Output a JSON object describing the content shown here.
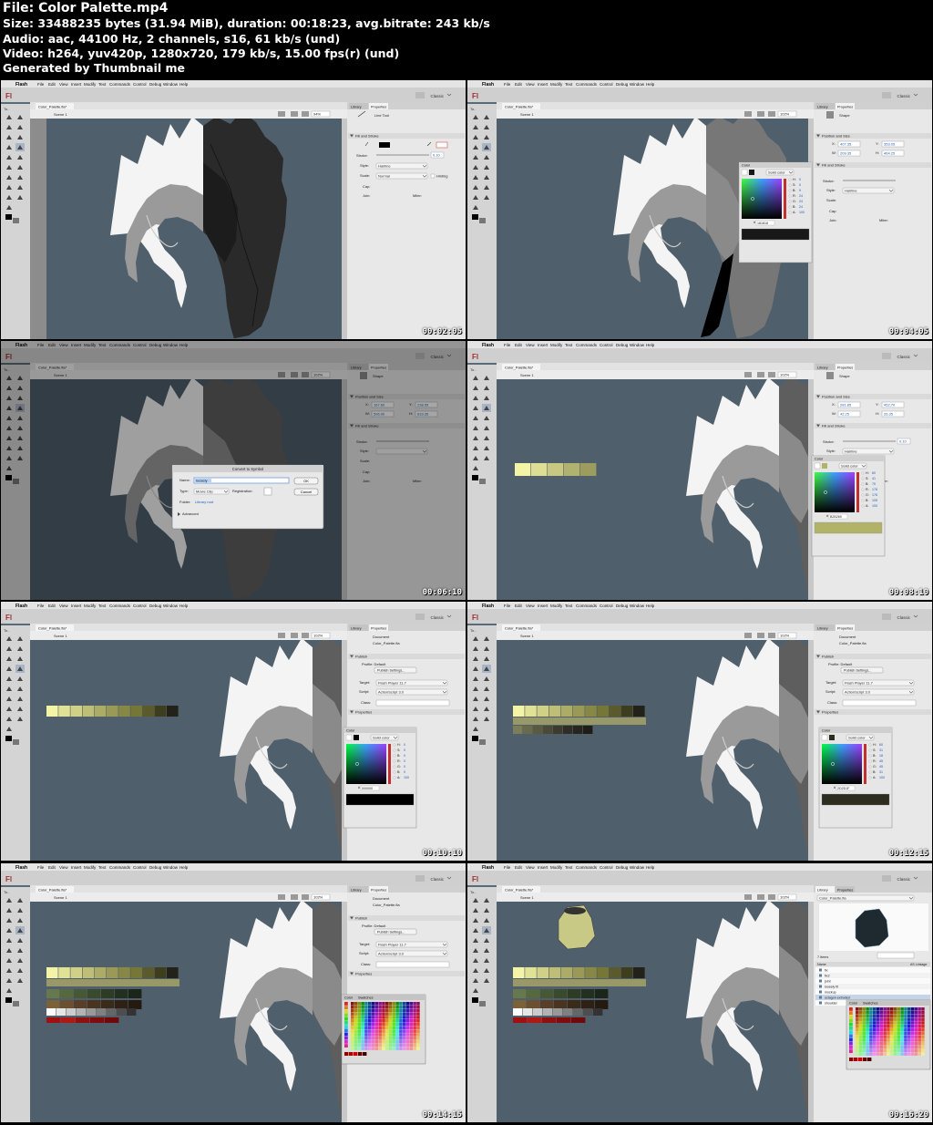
{
  "header": {
    "file": "File: Color Palette.mp4",
    "size": "Size: 33488235 bytes (31.94 MiB), duration: 00:18:23, avg.bitrate: 243 kb/s",
    "audio": "Audio: aac, 44100 Hz, 2 channels, s16, 61 kb/s (und)",
    "video": "Video: h264, yuv420p, 1280x720, 179 kb/s, 15.00 fps(r) (und)",
    "generated": "Generated by Thumbnail me"
  },
  "app": {
    "apple": "",
    "name": "Flash",
    "menus": [
      "File",
      "Edit",
      "View",
      "Insert",
      "Modify",
      "Text",
      "Commands",
      "Control",
      "Debug",
      "Window",
      "Help"
    ],
    "workspace": "Classic",
    "logo": "Fl",
    "doc_tab": "Color_Palette.fla*",
    "scene": "Scene 1",
    "tools_label": "To..",
    "panel_tabs": [
      "Library",
      "Properties"
    ]
  },
  "frames": [
    {
      "timestamp": "00:02:05",
      "zoom": "94%",
      "panel": "line-tool"
    },
    {
      "timestamp": "00:04:05",
      "zoom": "102%",
      "panel": "shape-color"
    },
    {
      "timestamp": "00:06:10",
      "zoom": "102%",
      "panel": "shape-dialog"
    },
    {
      "timestamp": "00:08:10",
      "zoom": "102%",
      "panel": "shape-color2"
    },
    {
      "timestamp": "00:10:10",
      "zoom": "102%",
      "panel": "document-color"
    },
    {
      "timestamp": "00:12:15",
      "zoom": "102%",
      "panel": "document-color2"
    },
    {
      "timestamp": "00:14:15",
      "zoom": "102%",
      "panel": "document-swatches"
    },
    {
      "timestamp": "00:16:20",
      "zoom": "102%",
      "panel": "library-swatches"
    }
  ],
  "line_tool": {
    "title": "Line Tool",
    "section": "Fill and Stroke",
    "stroke_label": "Stroke:",
    "stroke_value": "0.10",
    "style_label": "Style:",
    "style_value": "Hairline",
    "scale_label": "Scale:",
    "scale_value": "Normal",
    "hinting": "Hinting",
    "cap_label": "Cap:",
    "join_label": "Join:",
    "miter_label": "Miter:"
  },
  "shape": {
    "title": "Shape",
    "section_pos": "Position and Size",
    "x_label": "X:",
    "y_label": "Y:",
    "w_label": "W:",
    "h_label": "H:",
    "section_fill": "Fill and Stroke",
    "stroke_label": "Stroke:",
    "style_label": "Style:",
    "scale_label": "Scale:",
    "cap_label": "Cap:",
    "join_label": "Join:",
    "miter_label": "Miter:",
    "hinting": "Hinting"
  },
  "f2": {
    "x": "407.35",
    "y": "353.05",
    "w": "209.35",
    "h": "464.25",
    "hex": "181818",
    "fill_style": "Solid color",
    "style": "Hairline"
  },
  "f3": {
    "x": "167.60",
    "y": "238.55",
    "w": "596.90",
    "h": "633.35"
  },
  "f4": {
    "x": "281.85",
    "y": "452.70",
    "w": "42.25",
    "h": "26.35",
    "stroke": "0.10",
    "style": "Hairline",
    "hinting": "Hinting",
    "hex": "B2B269",
    "fill_style": "Solid color"
  },
  "color_panel": {
    "tab": "Color",
    "fill_style": "Solid color",
    "h": "H:",
    "s": "S:",
    "b": "B:",
    "r": "R:",
    "g": "G:",
    "bl": "B:",
    "a": "A:",
    "hash": "#"
  },
  "f5": {
    "hex": "000000",
    "h": "0",
    "s": "0",
    "b": "0",
    "r": "0",
    "g": "0",
    "bl": "0",
    "a": "100"
  },
  "f6": {
    "hex": "2D2D1F",
    "h": "60",
    "s": "31",
    "b": "18",
    "r": "45",
    "g": "45",
    "bl": "31",
    "a": "100"
  },
  "f4vals": {
    "h": "60",
    "s": "41",
    "b": "70",
    "r": "178",
    "g": "178",
    "bl": "105",
    "a": "100"
  },
  "f2vals": {
    "h": "0",
    "s": "0",
    "b": "9",
    "r": "24",
    "g": "24",
    "bl": "24",
    "a": "100"
  },
  "dialog": {
    "title": "Convert to Symbol",
    "name_label": "Name:",
    "name_value": "loosely",
    "type_label": "Type:",
    "type_value": "Movie Clip",
    "registration": "Registration:",
    "folder_label": "Folder:",
    "folder_value": "Library root",
    "advanced": "Advanced",
    "ok": "OK",
    "cancel": "Cancel"
  },
  "document": {
    "title": "Document",
    "file": "Color_Palette.fla",
    "section_publish": "Publish",
    "profile": "Profile: Default",
    "publish_settings": "Publish Settings...",
    "target_label": "Target:",
    "target_value": "Flash Player 11.7",
    "script_label": "Script:",
    "script_value": "ActionScript 3.0",
    "class_label": "Class:",
    "section_props": "Properties"
  },
  "swatches": {
    "tab_color": "Color",
    "tab_swatches": "Swatches"
  },
  "library": {
    "file": "Color_Palette.fla",
    "count": "7 items",
    "col_name": "Name",
    "col_link": "AS Linkage",
    "items": [
      "fix",
      "fix2",
      "joint",
      "loosely fit",
      "mockup",
      "octagon extruded",
      "shoulder"
    ]
  },
  "colors": {
    "stage": "#4f5f6b",
    "pasteboard": "#8c8c8c",
    "chrome": "#d8d8d8",
    "menubar": "#e4e4e4",
    "white_shape": "#f4f4f4",
    "mid_gray": "#9a9a9a",
    "dark_gray": "#2e2e2e",
    "accent": "#3c7fd1"
  },
  "palettes": {
    "yellow5": [
      "#f4f4a6",
      "#dede94",
      "#c8c882",
      "#b2b270",
      "#9c9c5e"
    ],
    "yellow11": [
      "#f4f4a6",
      "#e2e296",
      "#d0d086",
      "#bebe76",
      "#acac66",
      "#9a9a56",
      "#888846",
      "#767636",
      "#5a5a2a",
      "#3e3e1e",
      "#22221a"
    ],
    "olive_wide": "#989868",
    "olive_row": [
      "#7d7d5a",
      "#6a6a4c",
      "#5a5a40",
      "#4a4a36",
      "#3c3c2e",
      "#2e2e24",
      "#26261e",
      "#1e1e18"
    ],
    "green_row": [
      "#66784c",
      "#56683e",
      "#475834",
      "#3a4a2c",
      "#2e3c24",
      "#24301e",
      "#1c2618"
    ],
    "brown_row": [
      "#7c6038",
      "#6a5030",
      "#584028",
      "#483420",
      "#3a2a1a",
      "#2e2014",
      "#241a10"
    ],
    "gray_row": [
      "#ffffff",
      "#e6e6e6",
      "#cccccc",
      "#b3b3b3",
      "#999999",
      "#808080",
      "#666666",
      "#4d4d4d",
      "#333333"
    ],
    "red_row": [
      "#a01010",
      "#b01818",
      "#901010",
      "#800c0c",
      "#700a0a"
    ]
  }
}
